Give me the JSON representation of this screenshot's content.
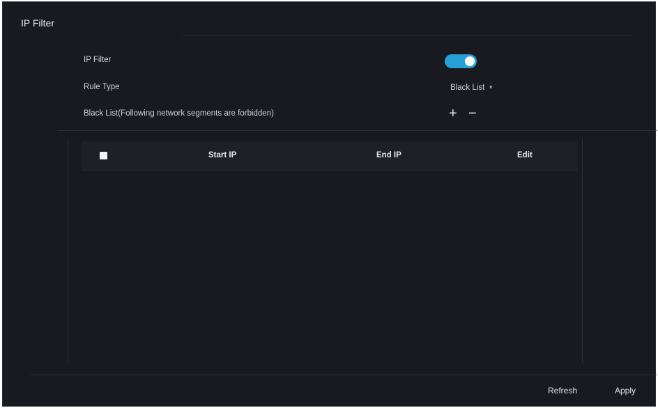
{
  "page": {
    "title": "IP Filter"
  },
  "form": {
    "ip_filter_label": "IP Filter",
    "ip_filter_enabled": true,
    "rule_type_label": "Rule Type",
    "rule_type_value": "Black List",
    "list_label": "Black List(Following network segments are forbidden)",
    "add_symbol": "+",
    "remove_symbol": "−"
  },
  "table": {
    "columns": [
      "Start IP",
      "End IP",
      "Edit"
    ],
    "rows": []
  },
  "actions": {
    "refresh_label": "Refresh",
    "apply_label": "Apply"
  },
  "colors": {
    "background": "#181a1f",
    "accent": "#27a0d8"
  },
  "icons": {
    "toggle": "toggle-switch-icon",
    "dropdown": "chevron-down-icon",
    "add": "plus-icon",
    "remove": "minus-icon"
  }
}
